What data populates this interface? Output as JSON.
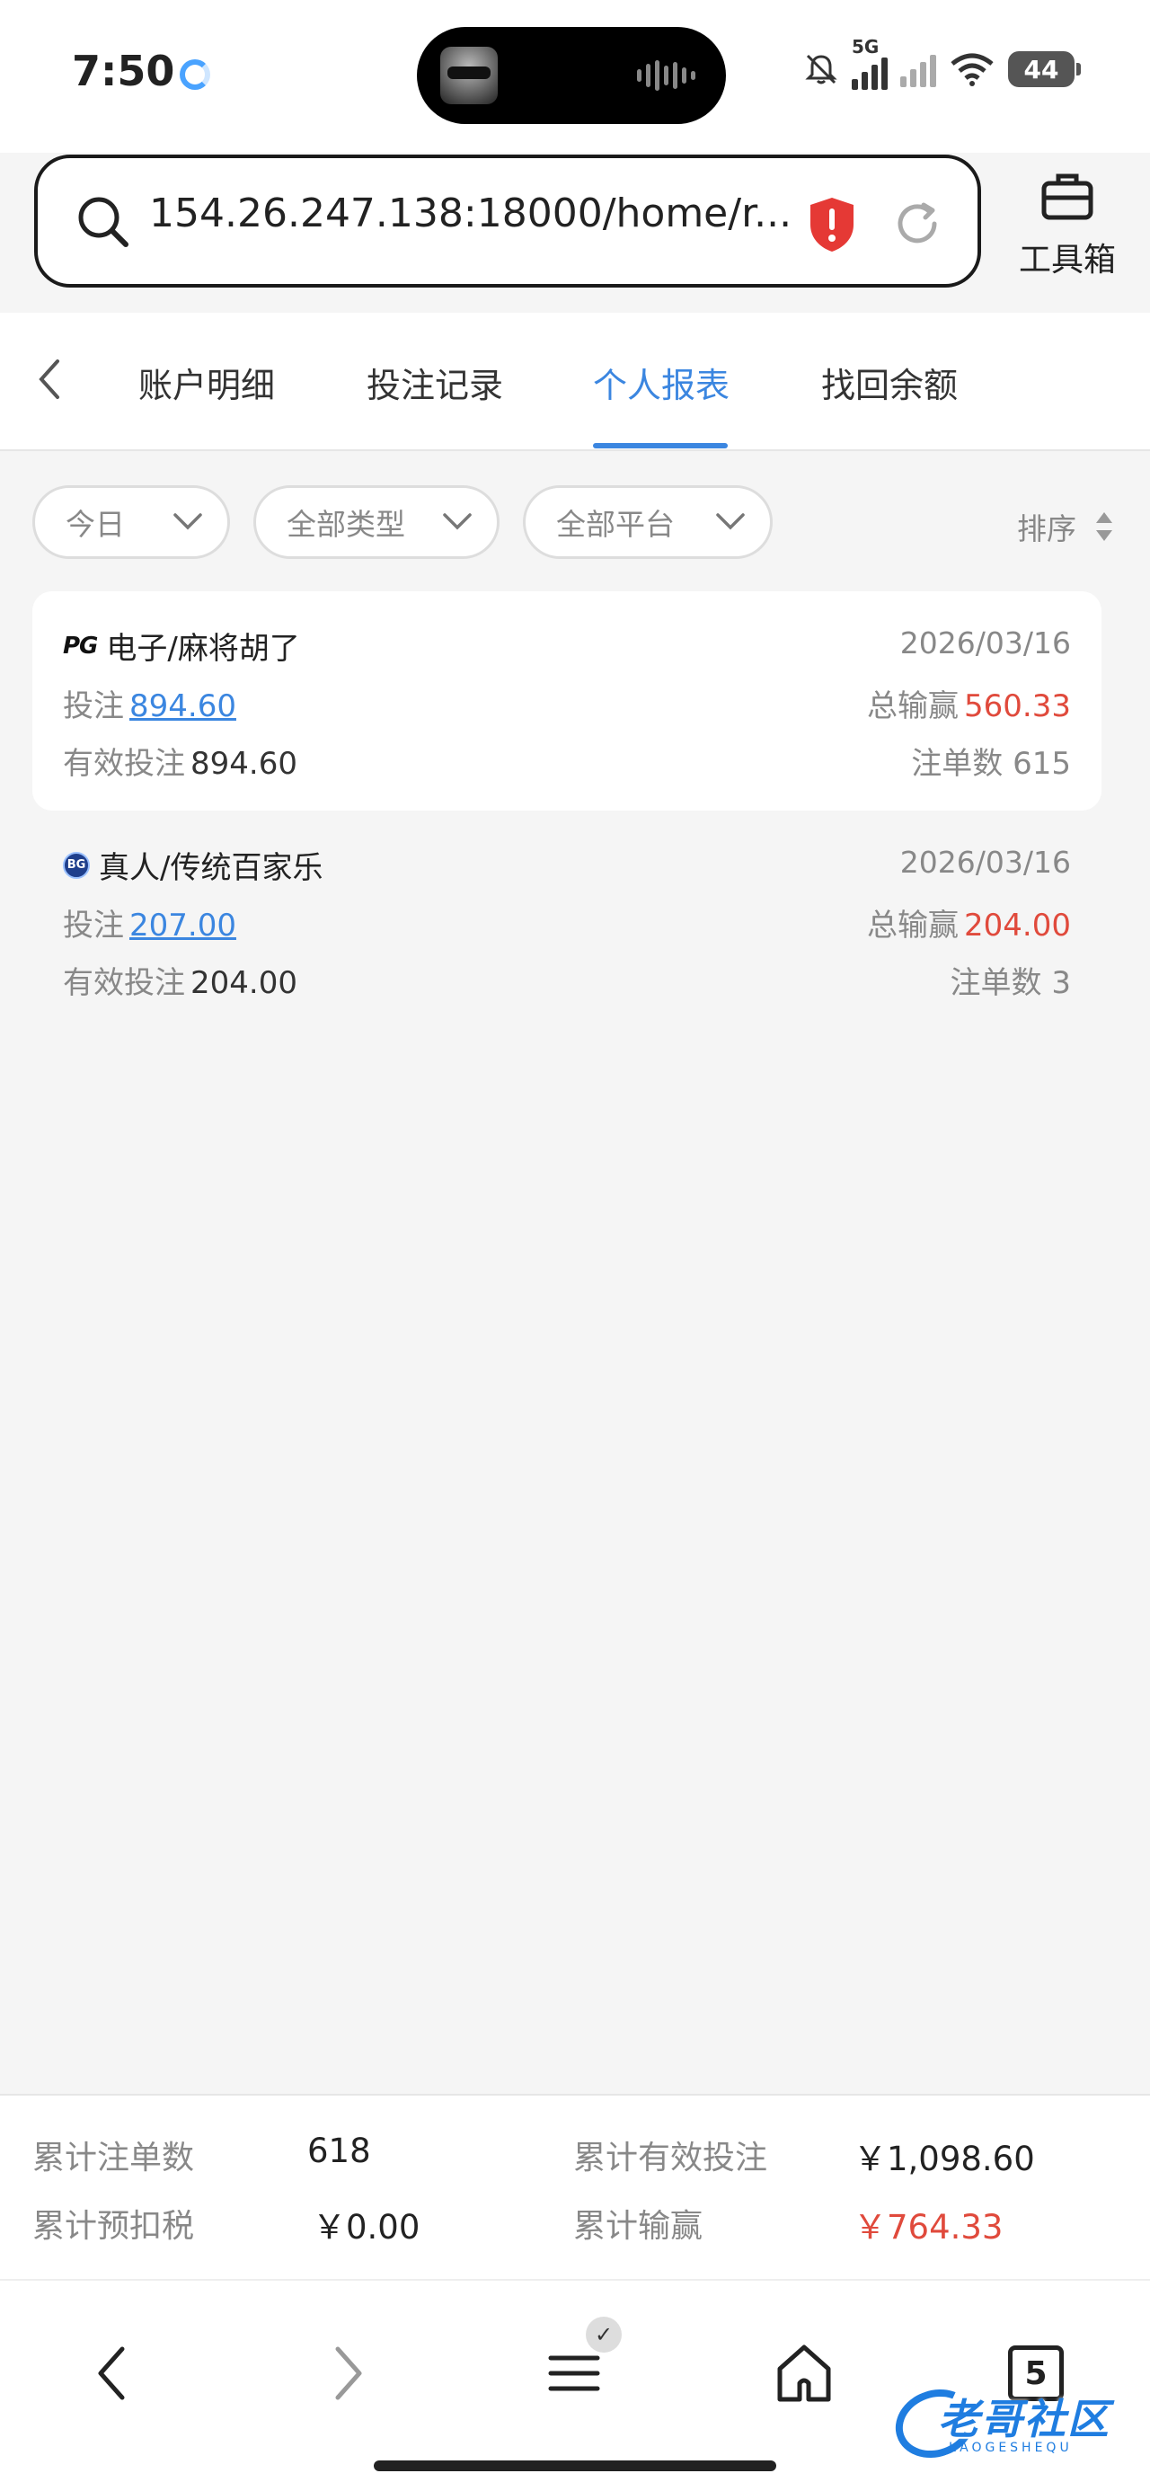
{
  "status_bar": {
    "time": "7:50",
    "network": "5G",
    "battery": "44"
  },
  "browser": {
    "url": "154.26.247.138:18000/home/r...",
    "toolbox_label": "工具箱"
  },
  "tabs": [
    {
      "label": "账户明细",
      "active": false
    },
    {
      "label": "投注记录",
      "active": false
    },
    {
      "label": "个人报表",
      "active": true
    },
    {
      "label": "找回余额",
      "active": false
    }
  ],
  "filters": {
    "date": "今日",
    "type": "全部类型",
    "platform": "全部平台",
    "sort": "排序"
  },
  "records": [
    {
      "logo": "PG",
      "title": "电子/麻将胡了",
      "date": "2026/03/16",
      "bet_label": "投注",
      "bet": "894.60",
      "win_label": "总输赢",
      "win": "560.33",
      "valid_label": "有效投注",
      "valid": "894.60",
      "count_label": "注单数",
      "count": "615"
    },
    {
      "logo": "BG",
      "title": "真人/传统百家乐",
      "date": "2026/03/16",
      "bet_label": "投注",
      "bet": "207.00",
      "win_label": "总输赢",
      "win": "204.00",
      "valid_label": "有效投注",
      "valid": "204.00",
      "count_label": "注单数",
      "count": "3"
    }
  ],
  "summary": {
    "total_orders_label": "累计注单数",
    "total_orders": "618",
    "total_valid_label": "累计有效投注",
    "total_valid": "￥1,098.60",
    "pre_tax_label": "累计预扣税",
    "pre_tax": "￥0.00",
    "total_win_label": "累计输赢",
    "total_win": "￥764.33"
  },
  "bottom_nav": {
    "tab_count": "5"
  },
  "watermark": {
    "text": "老哥社区",
    "sub": "LAOGESHEQU"
  },
  "colors": {
    "accent": "#3b86e0",
    "negative": "#e04a3c",
    "shield": "#e53935"
  }
}
